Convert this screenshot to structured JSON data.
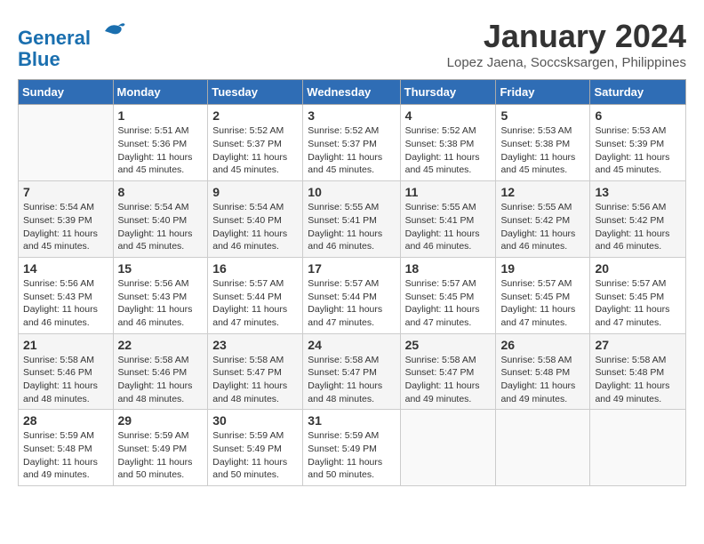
{
  "logo": {
    "line1": "General",
    "line2": "Blue"
  },
  "title": "January 2024",
  "location": "Lopez Jaena, Soccsksargen, Philippines",
  "days_header": [
    "Sunday",
    "Monday",
    "Tuesday",
    "Wednesday",
    "Thursday",
    "Friday",
    "Saturday"
  ],
  "weeks": [
    [
      {
        "num": "",
        "info": ""
      },
      {
        "num": "1",
        "info": "Sunrise: 5:51 AM\nSunset: 5:36 PM\nDaylight: 11 hours\nand 45 minutes."
      },
      {
        "num": "2",
        "info": "Sunrise: 5:52 AM\nSunset: 5:37 PM\nDaylight: 11 hours\nand 45 minutes."
      },
      {
        "num": "3",
        "info": "Sunrise: 5:52 AM\nSunset: 5:37 PM\nDaylight: 11 hours\nand 45 minutes."
      },
      {
        "num": "4",
        "info": "Sunrise: 5:52 AM\nSunset: 5:38 PM\nDaylight: 11 hours\nand 45 minutes."
      },
      {
        "num": "5",
        "info": "Sunrise: 5:53 AM\nSunset: 5:38 PM\nDaylight: 11 hours\nand 45 minutes."
      },
      {
        "num": "6",
        "info": "Sunrise: 5:53 AM\nSunset: 5:39 PM\nDaylight: 11 hours\nand 45 minutes."
      }
    ],
    [
      {
        "num": "7",
        "info": "Sunrise: 5:54 AM\nSunset: 5:39 PM\nDaylight: 11 hours\nand 45 minutes."
      },
      {
        "num": "8",
        "info": "Sunrise: 5:54 AM\nSunset: 5:40 PM\nDaylight: 11 hours\nand 45 minutes."
      },
      {
        "num": "9",
        "info": "Sunrise: 5:54 AM\nSunset: 5:40 PM\nDaylight: 11 hours\nand 46 minutes."
      },
      {
        "num": "10",
        "info": "Sunrise: 5:55 AM\nSunset: 5:41 PM\nDaylight: 11 hours\nand 46 minutes."
      },
      {
        "num": "11",
        "info": "Sunrise: 5:55 AM\nSunset: 5:41 PM\nDaylight: 11 hours\nand 46 minutes."
      },
      {
        "num": "12",
        "info": "Sunrise: 5:55 AM\nSunset: 5:42 PM\nDaylight: 11 hours\nand 46 minutes."
      },
      {
        "num": "13",
        "info": "Sunrise: 5:56 AM\nSunset: 5:42 PM\nDaylight: 11 hours\nand 46 minutes."
      }
    ],
    [
      {
        "num": "14",
        "info": "Sunrise: 5:56 AM\nSunset: 5:43 PM\nDaylight: 11 hours\nand 46 minutes."
      },
      {
        "num": "15",
        "info": "Sunrise: 5:56 AM\nSunset: 5:43 PM\nDaylight: 11 hours\nand 46 minutes."
      },
      {
        "num": "16",
        "info": "Sunrise: 5:57 AM\nSunset: 5:44 PM\nDaylight: 11 hours\nand 47 minutes."
      },
      {
        "num": "17",
        "info": "Sunrise: 5:57 AM\nSunset: 5:44 PM\nDaylight: 11 hours\nand 47 minutes."
      },
      {
        "num": "18",
        "info": "Sunrise: 5:57 AM\nSunset: 5:45 PM\nDaylight: 11 hours\nand 47 minutes."
      },
      {
        "num": "19",
        "info": "Sunrise: 5:57 AM\nSunset: 5:45 PM\nDaylight: 11 hours\nand 47 minutes."
      },
      {
        "num": "20",
        "info": "Sunrise: 5:57 AM\nSunset: 5:45 PM\nDaylight: 11 hours\nand 47 minutes."
      }
    ],
    [
      {
        "num": "21",
        "info": "Sunrise: 5:58 AM\nSunset: 5:46 PM\nDaylight: 11 hours\nand 48 minutes."
      },
      {
        "num": "22",
        "info": "Sunrise: 5:58 AM\nSunset: 5:46 PM\nDaylight: 11 hours\nand 48 minutes."
      },
      {
        "num": "23",
        "info": "Sunrise: 5:58 AM\nSunset: 5:47 PM\nDaylight: 11 hours\nand 48 minutes."
      },
      {
        "num": "24",
        "info": "Sunrise: 5:58 AM\nSunset: 5:47 PM\nDaylight: 11 hours\nand 48 minutes."
      },
      {
        "num": "25",
        "info": "Sunrise: 5:58 AM\nSunset: 5:47 PM\nDaylight: 11 hours\nand 49 minutes."
      },
      {
        "num": "26",
        "info": "Sunrise: 5:58 AM\nSunset: 5:48 PM\nDaylight: 11 hours\nand 49 minutes."
      },
      {
        "num": "27",
        "info": "Sunrise: 5:58 AM\nSunset: 5:48 PM\nDaylight: 11 hours\nand 49 minutes."
      }
    ],
    [
      {
        "num": "28",
        "info": "Sunrise: 5:59 AM\nSunset: 5:48 PM\nDaylight: 11 hours\nand 49 minutes."
      },
      {
        "num": "29",
        "info": "Sunrise: 5:59 AM\nSunset: 5:49 PM\nDaylight: 11 hours\nand 50 minutes."
      },
      {
        "num": "30",
        "info": "Sunrise: 5:59 AM\nSunset: 5:49 PM\nDaylight: 11 hours\nand 50 minutes."
      },
      {
        "num": "31",
        "info": "Sunrise: 5:59 AM\nSunset: 5:49 PM\nDaylight: 11 hours\nand 50 minutes."
      },
      {
        "num": "",
        "info": ""
      },
      {
        "num": "",
        "info": ""
      },
      {
        "num": "",
        "info": ""
      }
    ]
  ]
}
